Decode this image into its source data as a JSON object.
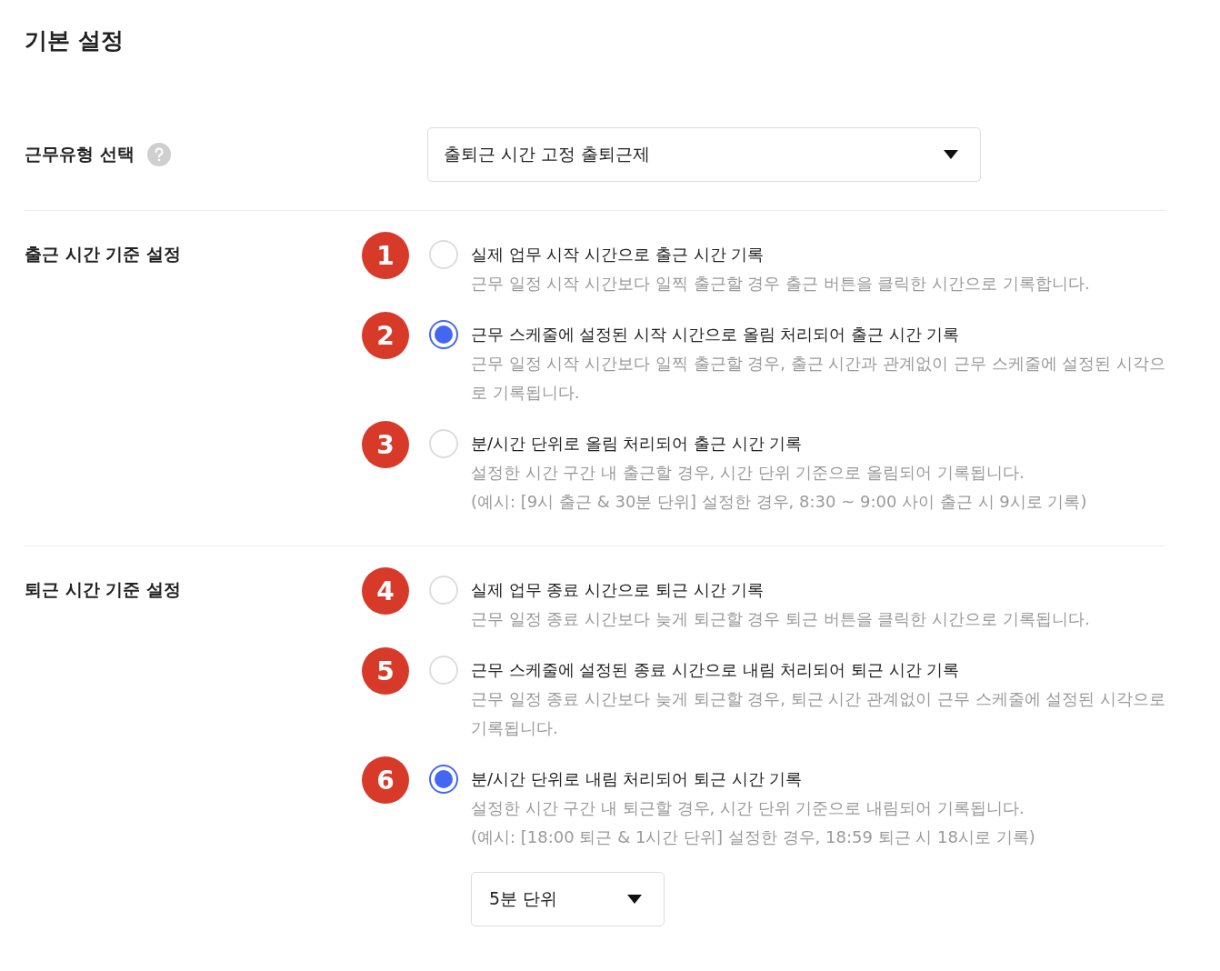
{
  "title": "기본 설정",
  "sections": [
    {
      "kind": "select",
      "label": "근무유형 선택",
      "help": true,
      "select": {
        "value": "출퇴근 시간 고정 출퇴근제"
      }
    },
    {
      "kind": "radio",
      "label": "출근 시간 기준 설정",
      "options": [
        {
          "marker": "1",
          "selected": false,
          "title": "실제 업무 시작 시간으로 출근 시간 기록",
          "lines": [
            "근무 일정 시작 시간보다 일찍 출근할 경우 출근 버튼을 클릭한 시간으로 기록합니다."
          ]
        },
        {
          "marker": "2",
          "selected": true,
          "title": "근무 스케줄에 설정된 시작 시간으로 올림 처리되어 출근 시간 기록",
          "lines": [
            "근무 일정 시작 시간보다 일찍 출근할 경우, 출근 시간과 관계없이 근무 스케줄에 설정된 시각으로 기록됩니다."
          ]
        },
        {
          "marker": "3",
          "selected": false,
          "title": "분/시간 단위로 올림 처리되어 출근 시간 기록",
          "lines": [
            "설정한 시간 구간 내 출근할 경우, 시간 단위 기준으로 올림되어 기록됩니다.",
            "(예시: [9시 출근 & 30분 단위] 설정한 경우, 8:30 ~ 9:00 사이 출근 시 9시로 기록)"
          ]
        }
      ]
    },
    {
      "kind": "radio",
      "label": "퇴근 시간 기준 설정",
      "options": [
        {
          "marker": "4",
          "selected": false,
          "title": "실제 업무 종료 시간으로 퇴근 시간 기록",
          "lines": [
            "근무 일정 종료 시간보다 늦게 퇴근할 경우 퇴근 버튼을 클릭한 시간으로 기록됩니다."
          ]
        },
        {
          "marker": "5",
          "selected": false,
          "title": "근무 스케줄에 설정된 종료 시간으로 내림 처리되어 퇴근 시간 기록",
          "lines": [
            "근무 일정 종료 시간보다 늦게 퇴근할 경우, 퇴근 시간 관계없이 근무 스케줄에 설정된 시각으로 기록됩니다."
          ]
        },
        {
          "marker": "6",
          "selected": true,
          "title": "분/시간 단위로 내림 처리되어 퇴근 시간 기록",
          "lines": [
            "설정한 시간 구간 내 퇴근할 경우, 시간 단위 기준으로 내림되어 기록됩니다.",
            "(예시: [18:00 퇴근 & 1시간 단위] 설정한 경우, 18:59 퇴근 시 18시로 기록)"
          ],
          "select": {
            "value": "5분 단위"
          }
        }
      ]
    }
  ]
}
